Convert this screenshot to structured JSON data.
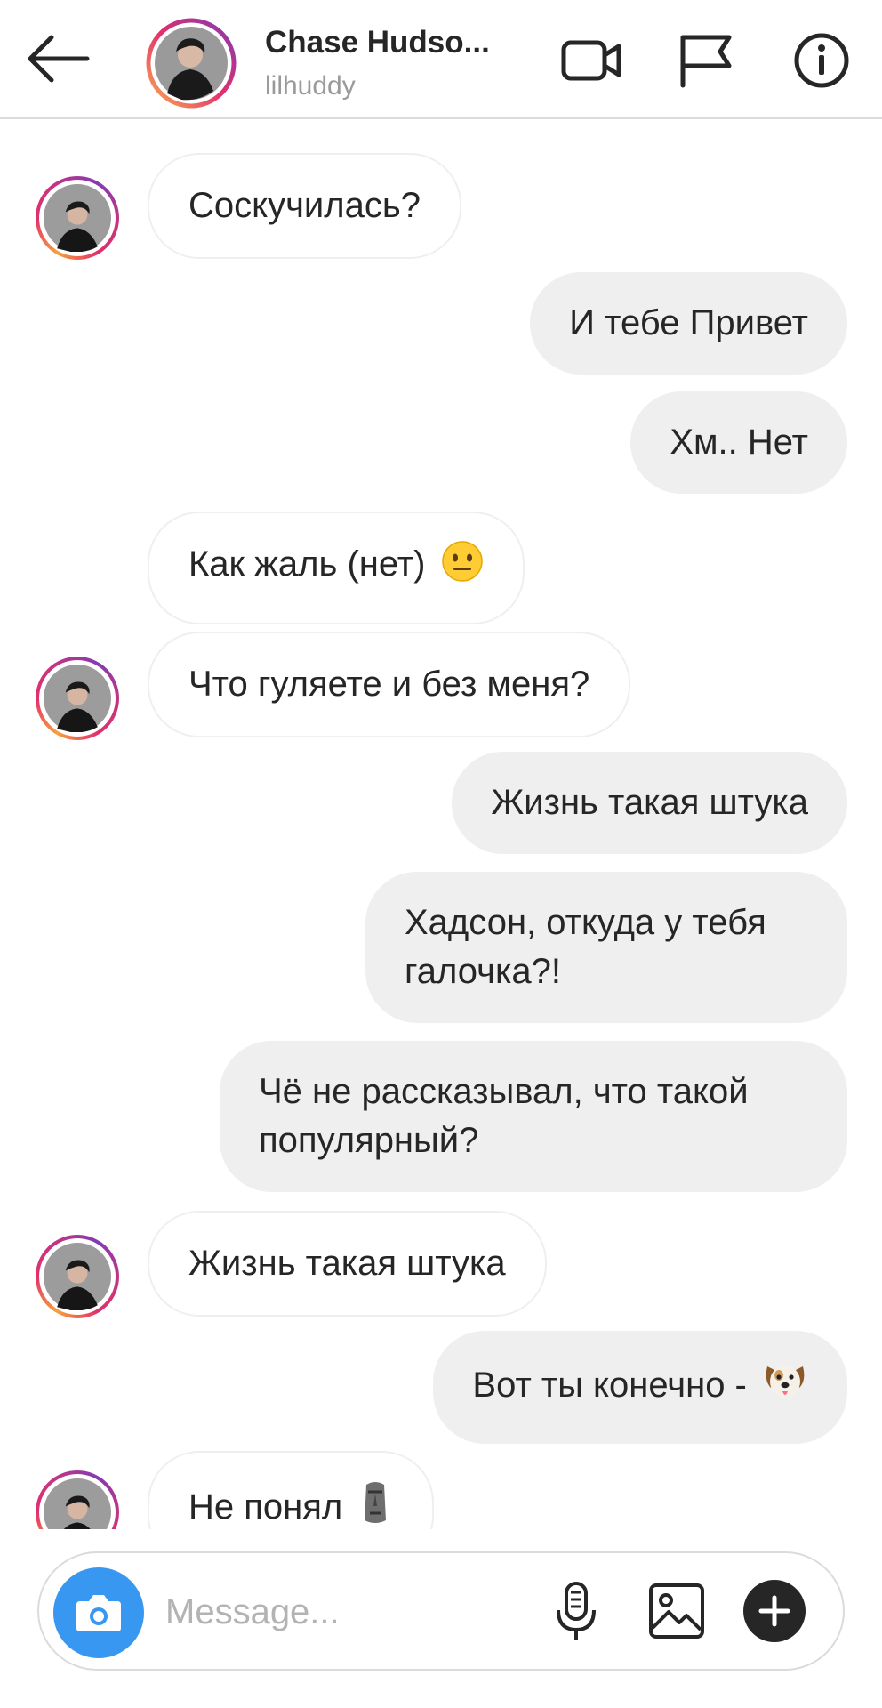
{
  "header": {
    "title": "Chase Hudso...",
    "username": "lilhuddy",
    "back_icon": "arrow-left-icon",
    "video_icon": "video-camera-icon",
    "flag_icon": "flag-icon",
    "info_icon": "info-icon"
  },
  "messages": [
    {
      "direction": "in",
      "text": "Соскучилась?"
    },
    {
      "direction": "out",
      "text": "И тебе Привет"
    },
    {
      "direction": "out",
      "text": "Хм.. Нет"
    },
    {
      "direction": "in",
      "text": "Как жаль (нет)",
      "emoji": "neutral-face"
    },
    {
      "direction": "in",
      "text": "Что гуляете и без меня?"
    },
    {
      "direction": "out",
      "text": "Жизнь такая штука"
    },
    {
      "direction": "out",
      "text": "Хадсон, откуда у тебя галочка?!"
    },
    {
      "direction": "out",
      "text": "Чё не рассказывал, что такой популярный?"
    },
    {
      "direction": "in",
      "text": "Жизнь такая штука"
    },
    {
      "direction": "out",
      "text": "Вот ты конечно -",
      "emoji": "dog-face"
    },
    {
      "direction": "in",
      "text": "Не понял",
      "emoji": "moai"
    }
  ],
  "composer": {
    "placeholder": "Message...",
    "camera_icon": "camera-icon",
    "mic_icon": "microphone-icon",
    "gallery_icon": "image-icon",
    "plus_icon": "plus-icon"
  },
  "colors": {
    "camera_button": "#3897f0",
    "outgoing_bubble": "#efefef",
    "text": "#262626",
    "muted": "#9a9a9a"
  }
}
